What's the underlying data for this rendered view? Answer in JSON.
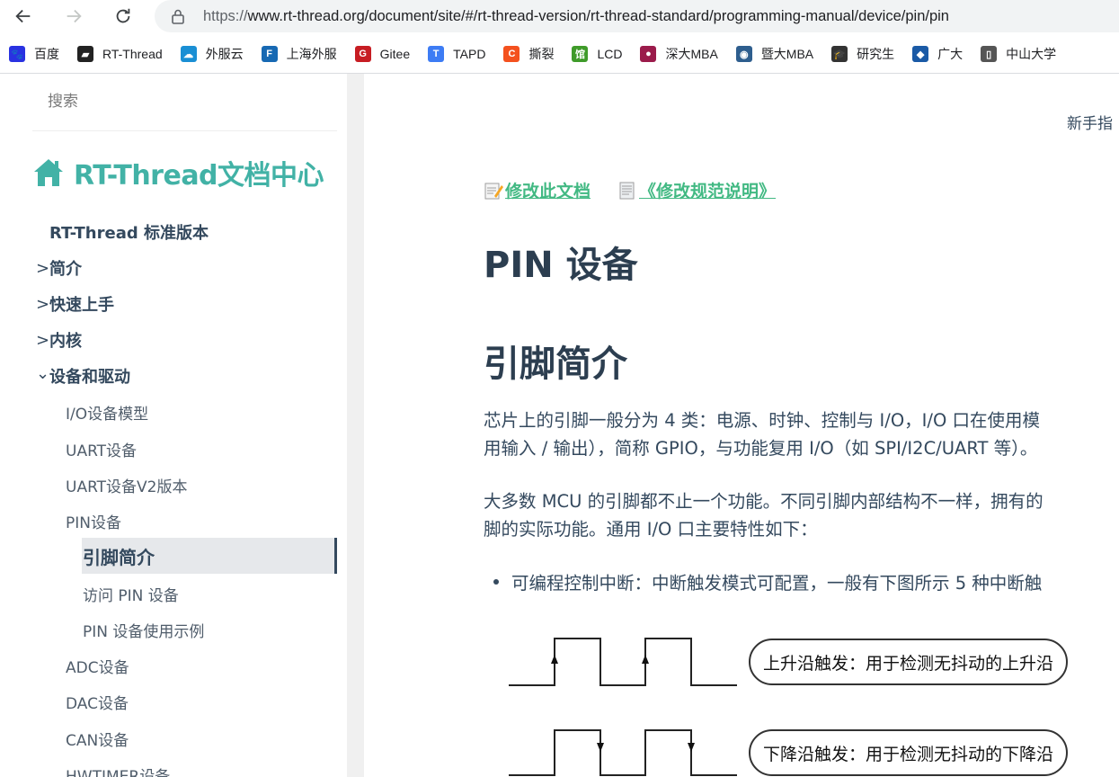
{
  "browser": {
    "url_scheme": "https://",
    "url_rest": "www.rt-thread.org/document/site/#/rt-thread-version/rt-thread-standard/programming-manual/device/pin/pin",
    "bookmarks": [
      {
        "label": "百度",
        "color": "#2932e1",
        "glyph": "🐾"
      },
      {
        "label": "RT-Thread",
        "color": "#222222",
        "glyph": "▰"
      },
      {
        "label": "外服云",
        "color": "#1a8fd4",
        "glyph": "☁"
      },
      {
        "label": "上海外服",
        "color": "#1769b3",
        "glyph": "F"
      },
      {
        "label": "Gitee",
        "color": "#c71d23",
        "glyph": "G"
      },
      {
        "label": "TAPD",
        "color": "#3d7cf4",
        "glyph": "T"
      },
      {
        "label": "撕裂",
        "color": "#f4511e",
        "glyph": "C"
      },
      {
        "label": "LCD",
        "color": "#3f9b2a",
        "glyph": "馆"
      },
      {
        "label": "深大MBA",
        "color": "#9b1b4b",
        "glyph": "●"
      },
      {
        "label": "暨大MBA",
        "color": "#2e5e8e",
        "glyph": "◉"
      },
      {
        "label": "研究生",
        "color": "#333333",
        "glyph": "🎓"
      },
      {
        "label": "广大",
        "color": "#1a5aa6",
        "glyph": "◆"
      },
      {
        "label": "中山大学",
        "color": "#555555",
        "glyph": "▯"
      }
    ]
  },
  "sidebar": {
    "search_placeholder": "搜索",
    "brand": "RT-Thread文档中心",
    "root": "RT-Thread 标准版本",
    "sections": [
      {
        "label": "简介",
        "chevron": ">"
      },
      {
        "label": "快速上手",
        "chevron": ">"
      },
      {
        "label": "内核",
        "chevron": ">"
      },
      {
        "label": "设备和驱动",
        "chevron": "⌄"
      }
    ],
    "sub_items": [
      "I/O设备模型",
      "UART设备",
      "UART设备V2版本",
      "PIN设备"
    ],
    "pin_children": [
      "引脚简介",
      "访问 PIN 设备",
      "PIN 设备使用示例"
    ],
    "more_items": [
      "ADC设备",
      "DAC设备",
      "CAN设备",
      "HWTIMER设备"
    ]
  },
  "content": {
    "topnav": "新手指",
    "edit_link": "修改此文档",
    "spec_link": "《修改规范说明》",
    "title": "PIN 设备",
    "section_title": "引脚简介",
    "para1_line1": "芯片上的引脚一般分为 4 类：电源、时钟、控制与 I/O，I/O 口在使用模",
    "para1_line2": "用输入 / 输出），简称 GPIO，与功能复用 I/O（如 SPI/I2C/UART 等）。",
    "para2_line1": "大多数 MCU 的引脚都不止一个功能。不同引脚内部结构不一样，拥有的",
    "para2_line2": "脚的实际功能。通用 I/O 口主要特性如下：",
    "bullet1": "可编程控制中断：中断触发模式可配置，一般有下图所示 5 种中断触",
    "trigger_rising": "上升沿触发：用于检测无抖动的上升沿",
    "trigger_falling": "下降沿触发：用于检测无抖动的下降沿"
  },
  "colors": {
    "accent": "#42b983",
    "brand": "#42b2a6",
    "text": "#34495e"
  }
}
